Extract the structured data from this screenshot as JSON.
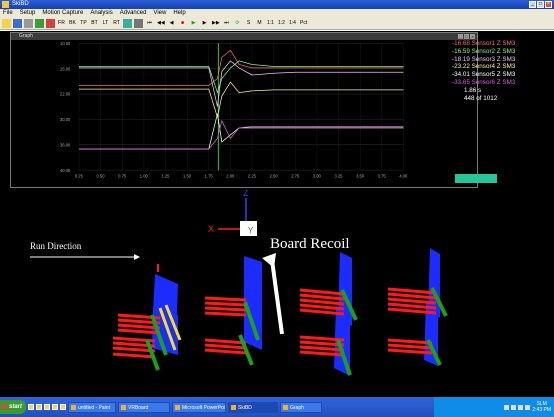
{
  "window": {
    "title": "SkiBD"
  },
  "menu": [
    "File",
    "Setup",
    "Motion Capture",
    "Analysis",
    "Advanced",
    "View",
    "Help"
  ],
  "toolbar": {
    "buttons": [
      "FR",
      "BK",
      "TP",
      "BT",
      "LT",
      "RT",
      "S",
      "M",
      "1:1",
      "1:2",
      "1:4",
      "Pct"
    ]
  },
  "graph": {
    "title": "Graph",
    "legend": [
      {
        "text": "-16.68  Sensor1 Z SM3",
        "color": "#ff6a6a"
      },
      {
        "text": "-16.59  Sensor2 Z SM3",
        "color": "#7cff7c"
      },
      {
        "text": "-18.19  Sensor3 Z SM3",
        "color": "#f0c0ff"
      },
      {
        "text": "-23.22  Sensor4 Z SM3",
        "color": "#fff59a"
      },
      {
        "text": "-34.01  Sensor5 Z SM3",
        "color": "#ffffff"
      },
      {
        "text": "-33.65  Sensor6 Z SM3",
        "color": "#e060e0"
      }
    ],
    "time": "1.86   s",
    "frame": "448 of 1012"
  },
  "chart_data": {
    "type": "line",
    "x": [
      0.25,
      0.5,
      0.75,
      1.0,
      1.25,
      1.5,
      1.75,
      1.85,
      1.9,
      2.0,
      2.1,
      2.25,
      2.5,
      2.75,
      3.0,
      3.25,
      3.5,
      3.75,
      4.0
    ],
    "xticks": [
      "0.25",
      "0.50",
      "0.75",
      "1.00",
      "1.25",
      "1.50",
      "1.75",
      "2.00",
      "2.25",
      "2.50",
      "2.75",
      "3.00",
      "3.25",
      "3.50",
      "3.75",
      "4.00"
    ],
    "yticks": [
      "10.00",
      "15.00",
      "22.00",
      "30.00",
      "36.00",
      "40.00"
    ],
    "ylim": [
      -46,
      -10
    ],
    "cursor_x": 1.86,
    "series": [
      {
        "name": "Sensor1 Z SM3",
        "color": "#ff6a6a",
        "values": [
          -22,
          -22,
          -22,
          -22,
          -22,
          -22,
          -22,
          -20,
          -14,
          -12,
          -16,
          -17,
          -17,
          -17,
          -17,
          -17,
          -17,
          -17,
          -17
        ]
      },
      {
        "name": "Sensor2 Z SM3",
        "color": "#7cff7c",
        "values": [
          -16.6,
          -16.6,
          -16.6,
          -16.6,
          -16.6,
          -16.6,
          -16.6,
          -24,
          -20,
          -17,
          -15,
          -16,
          -16.6,
          -16.6,
          -16.6,
          -16.6,
          -16.6,
          -16.6,
          -16.6
        ]
      },
      {
        "name": "Sensor3 Z SM3",
        "color": "#f0c0ff",
        "values": [
          -17,
          -17,
          -17,
          -17,
          -17,
          -17,
          -17,
          -28,
          -18,
          -15,
          -17,
          -19,
          -18.5,
          -18.2,
          -18.2,
          -18.2,
          -18.2,
          -18.2,
          -18.2
        ]
      },
      {
        "name": "Sensor4 Z SM3",
        "color": "#fff59a",
        "values": [
          -23,
          -23,
          -23,
          -23,
          -23,
          -23,
          -23,
          -31,
          -25,
          -21,
          -24,
          -23.5,
          -23.2,
          -23.2,
          -23.2,
          -23.2,
          -23.2,
          -23.2,
          -23.2
        ]
      },
      {
        "name": "Sensor5 Z SM3",
        "color": "#ffffff",
        "values": [
          -40,
          -40,
          -40,
          -40,
          -40,
          -40,
          -40,
          -30,
          -38,
          -36,
          -34,
          -34,
          -34,
          -34,
          -34,
          -34,
          -34,
          -34,
          -34
        ]
      },
      {
        "name": "Sensor6 Z SM3",
        "color": "#e060e0",
        "values": [
          -40,
          -40,
          -40,
          -40,
          -40,
          -40,
          -40,
          -37,
          -32,
          -37,
          -34,
          -33.6,
          -33.6,
          -33.6,
          -33.6,
          -33.6,
          -33.6,
          -33.6,
          -33.6
        ]
      }
    ]
  },
  "scene": {
    "axis_z": "Z",
    "axis_x": "X",
    "axis_y": "Y",
    "run_direction": "Run Direction",
    "annotation": "Board Recoil"
  },
  "taskbar": {
    "start": "start",
    "items": [
      "untitled - Paint",
      "VRBoard",
      "Microsoft PowerPoi...",
      "SkiBD",
      "Graph"
    ],
    "tray_text": "SLM",
    "clock": "2:43 PM"
  }
}
